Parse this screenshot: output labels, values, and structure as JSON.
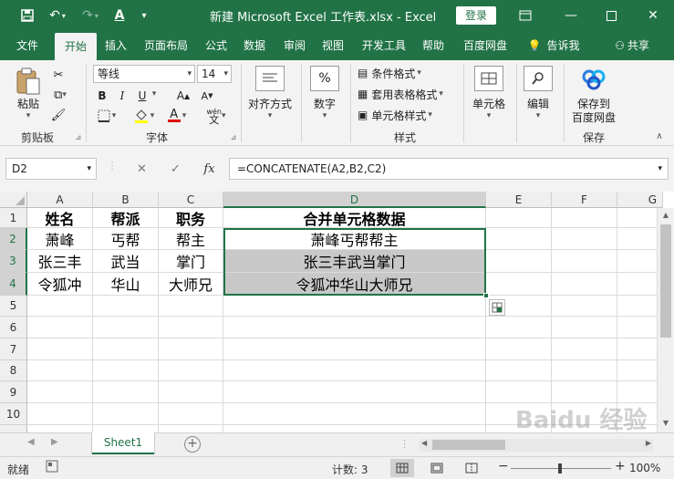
{
  "window": {
    "title": "新建 Microsoft Excel 工作表.xlsx  -  Excel",
    "login_label": "登录"
  },
  "tabs": [
    {
      "label": "文件"
    },
    {
      "label": "开始"
    },
    {
      "label": "插入"
    },
    {
      "label": "页面布局"
    },
    {
      "label": "公式"
    },
    {
      "label": "数据"
    },
    {
      "label": "审阅"
    },
    {
      "label": "视图"
    },
    {
      "label": "开发工具"
    },
    {
      "label": "帮助"
    },
    {
      "label": "百度网盘"
    },
    {
      "label": "告诉我"
    },
    {
      "label": "共享"
    }
  ],
  "ribbon": {
    "paste_label": "粘贴",
    "clipboard_label": "剪贴板",
    "font_name": "等线",
    "font_size": "14",
    "font_label": "字体",
    "align_label": "对齐方式",
    "number_label": "数字",
    "cond_format_label": "条件格式",
    "table_format_label": "套用表格格式",
    "cell_style_label": "单元格样式",
    "styles_label": "样式",
    "cells_label": "单元格",
    "edit_label": "编辑",
    "save_baidu_label_1": "保存到",
    "save_baidu_label_2": "百度网盘",
    "save_label": "保存",
    "bold": "B",
    "italic": "I",
    "underline": "U",
    "grow_font": "A",
    "shrink_font": "A",
    "font_color": "A",
    "percent": "%",
    "wen": "wén"
  },
  "formula_bar": {
    "name_box": "D2",
    "cancel": "✕",
    "enter": "✓",
    "fx": "fx",
    "formula": "=CONCATENATE(A2,B2,C2)"
  },
  "grid": {
    "columns": [
      "A",
      "B",
      "C",
      "D",
      "E",
      "F",
      "G"
    ],
    "rows": [
      "1",
      "2",
      "3",
      "4",
      "5",
      "6",
      "7",
      "8",
      "9",
      "10"
    ],
    "headers": [
      "姓名",
      "帮派",
      "职务",
      "合并单元格数据"
    ],
    "data": [
      [
        "萧峰",
        "丐帮",
        "帮主",
        "萧峰丐帮帮主"
      ],
      [
        "张三丰",
        "武当",
        "掌门",
        "张三丰武当掌门"
      ],
      [
        "令狐冲",
        "华山",
        "大师兄",
        "令狐冲华山大师兄"
      ]
    ]
  },
  "sheet": {
    "name": "Sheet1",
    "add": "+"
  },
  "status": {
    "ready": "就绪",
    "count": "计数: 3",
    "zoom": "100%",
    "minus": "−",
    "plus": "+"
  },
  "watermark": "Baidu 经验"
}
